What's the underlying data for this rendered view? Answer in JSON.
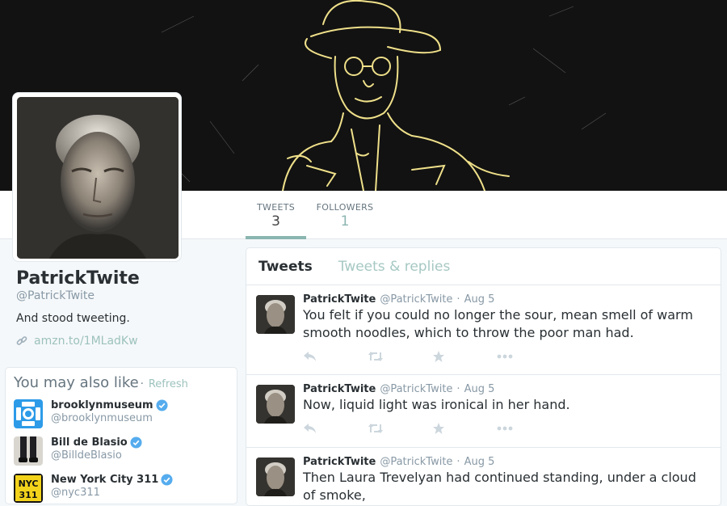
{
  "profile": {
    "name": "PatrickTwite",
    "handle": "@PatrickTwite",
    "bio": "And stood tweeting.",
    "link": "amzn.to/1MLadKw"
  },
  "nav": {
    "tweets_label": "TWEETS",
    "tweets_count": "3",
    "followers_label": "FOLLOWERS",
    "followers_count": "1"
  },
  "who_to_follow": {
    "title": "You may also like",
    "dot": "·",
    "refresh": "Refresh",
    "accounts": [
      {
        "name": "brooklynmuseum",
        "handle": "@brooklynmuseum",
        "verified": true
      },
      {
        "name": "Bill de Blasio",
        "handle": "@BilldeBlasio",
        "verified": true
      },
      {
        "name": "New York City 311",
        "handle": "@nyc311",
        "verified": true
      }
    ]
  },
  "timeline": {
    "tabs": [
      "Tweets",
      "Tweets & replies"
    ],
    "tweets": [
      {
        "name": "PatrickTwite",
        "handle": "@PatrickTwite",
        "dot": "·",
        "time": "Aug 5",
        "text": "You felt if you could no longer the sour, mean smell of warm smooth noodles, which to throw the poor man had."
      },
      {
        "name": "PatrickTwite",
        "handle": "@PatrickTwite",
        "dot": "·",
        "time": "Aug 5",
        "text": "Now, liquid light was ironical in her hand."
      },
      {
        "name": "PatrickTwite",
        "handle": "@PatrickTwite",
        "dot": "·",
        "time": "Aug 5",
        "text": "Then Laura Trevelyan had continued standing, under a cloud of smoke,"
      }
    ]
  },
  "colors": {
    "accent": "#8bb5b0",
    "link": "#9cc2bd",
    "verified": "#55acee",
    "banner_bg": "#121212",
    "sketch": "#efe08a"
  }
}
